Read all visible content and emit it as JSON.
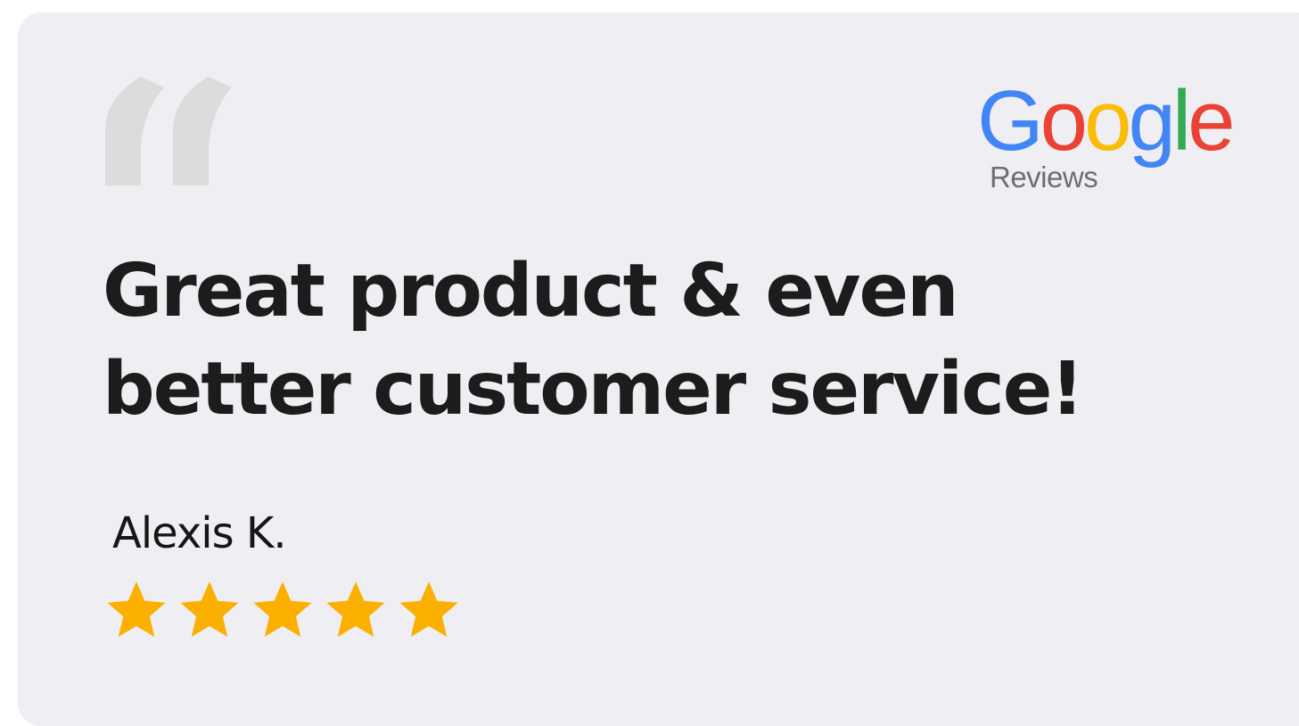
{
  "review": {
    "headline_line1": "Great product & even",
    "headline_line2": "better customer service!",
    "reviewer_name": "Alexis K.",
    "rating": 5,
    "rating_max": 5
  },
  "brand": {
    "logo_text": "Google",
    "logo_sub": "Reviews",
    "letters": [
      {
        "char": "G",
        "color": "#4285F4"
      },
      {
        "char": "o",
        "color": "#EA4335"
      },
      {
        "char": "o",
        "color": "#FBBC05"
      },
      {
        "char": "g",
        "color": "#4285F4"
      },
      {
        "char": "l",
        "color": "#34A853"
      },
      {
        "char": "e",
        "color": "#EA4335"
      }
    ]
  },
  "colors": {
    "card_background": "#efeff3",
    "quote_mark": "#dcdcdc",
    "star": "#FBB000",
    "text": "#1c1c1c"
  },
  "icons": {
    "quote": "quote-mark-icon",
    "star": "star-icon"
  }
}
